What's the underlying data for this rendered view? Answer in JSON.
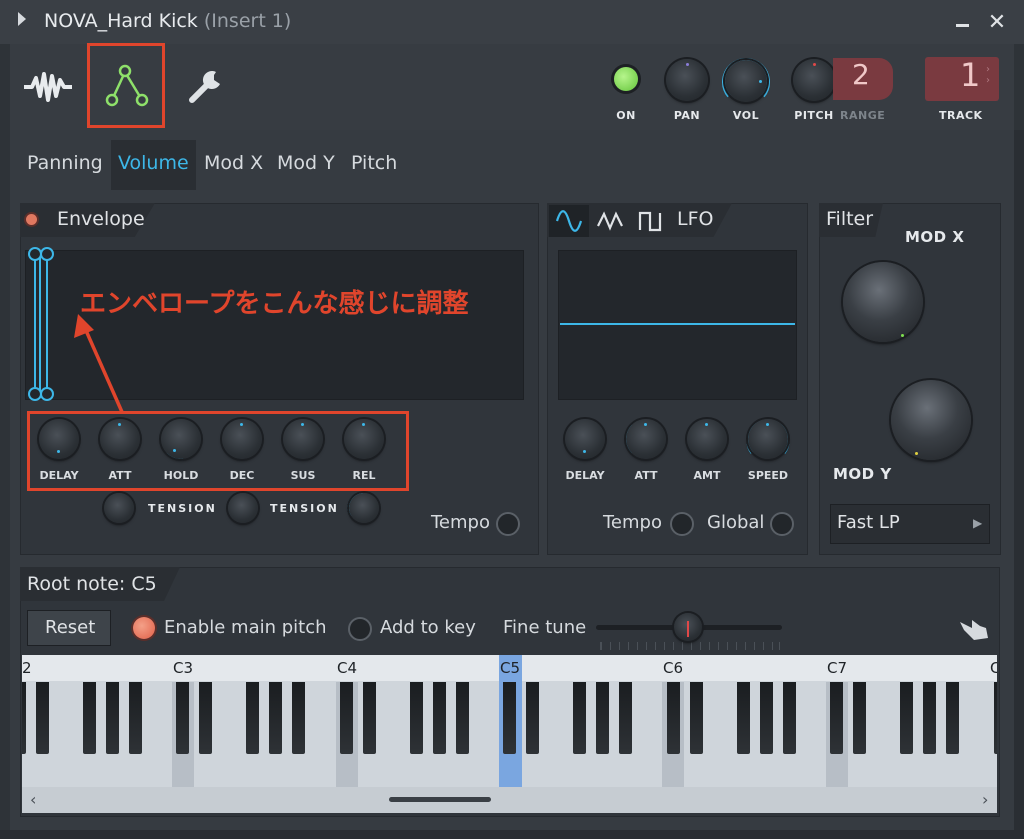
{
  "title": {
    "name": "NOVA_Hard Kick",
    "sub": "(Insert 1)"
  },
  "toolbar": {
    "on_label": "ON",
    "pan_label": "PAN",
    "vol_label": "VOL",
    "pitch_label": "PITCH",
    "range_label": "RANGE",
    "range_value": "2",
    "track_label": "TRACK",
    "track_value": "1"
  },
  "tabs": [
    "Panning",
    "Volume",
    "Mod X",
    "Mod Y",
    "Pitch"
  ],
  "envelope": {
    "title": "Envelope",
    "annotation": "エンベロープをこんな感じに調整",
    "knobs": [
      "DELAY",
      "ATT",
      "HOLD",
      "DEC",
      "SUS",
      "REL"
    ],
    "tension_labels": [
      "TENSION",
      "TENSION"
    ],
    "tempo_label": "Tempo"
  },
  "lfo": {
    "title": "LFO",
    "knobs": [
      "DELAY",
      "ATT",
      "AMT",
      "SPEED"
    ],
    "tempo_label": "Tempo",
    "global_label": "Global"
  },
  "filter": {
    "title": "Filter",
    "modx_label": "MOD X",
    "mody_label": "MOD Y",
    "type_value": "Fast LP"
  },
  "root": {
    "title": "Root note: C5",
    "reset_label": "Reset",
    "enable_main_pitch": "Enable main pitch",
    "add_to_key": "Add to key",
    "fine_tune": "Fine tune"
  },
  "keyboard": {
    "labels": [
      "2",
      "C3",
      "C4",
      "C5",
      "C6",
      "C7",
      "C"
    ],
    "highlight": "C5"
  },
  "colors": {
    "accent": "#3db7e8",
    "annotation": "#e0452c",
    "led_on": "#7fe050",
    "env_icon": "#8ee06a"
  }
}
